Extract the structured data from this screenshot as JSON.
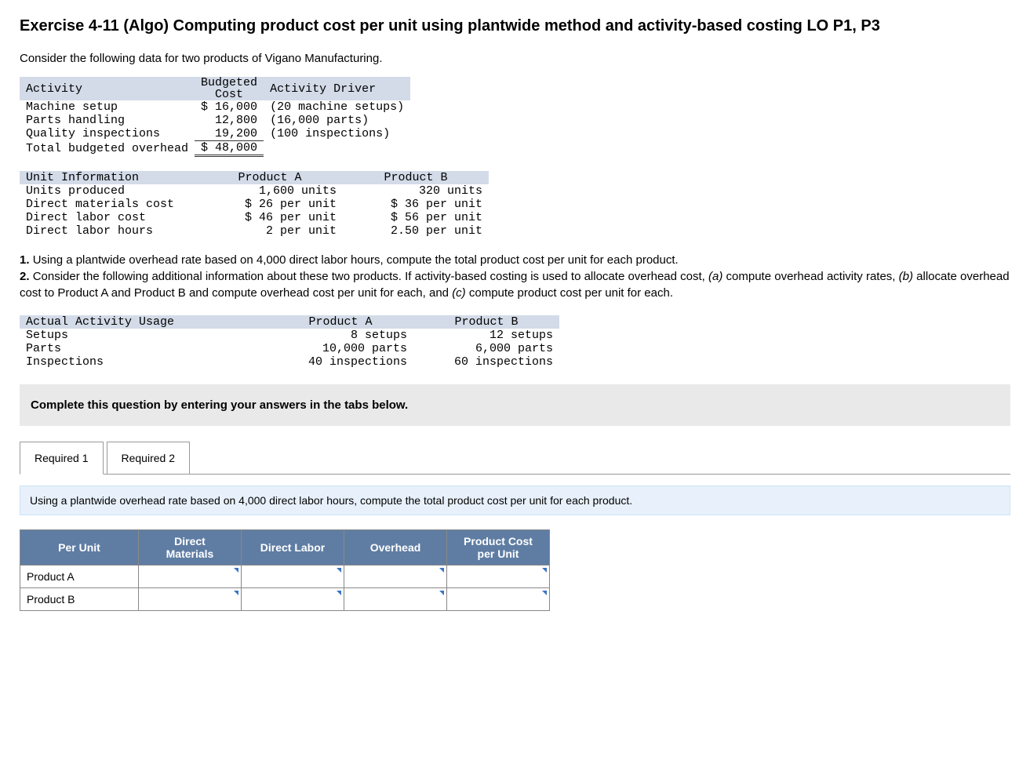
{
  "title": "Exercise 4-11 (Algo) Computing product cost per unit using plantwide method and activity-based costing LO P1, P3",
  "intro": "Consider the following data for two products of Vigano Manufacturing.",
  "table1": {
    "headers": {
      "activity": "Activity",
      "budgeted": "Budgeted\nCost",
      "driver": "Activity Driver"
    },
    "rows": [
      {
        "activity": "Machine setup",
        "cost": "$ 16,000",
        "driver": "(20 machine setups)"
      },
      {
        "activity": "Parts handling",
        "cost": "12,800",
        "driver": "(16,000 parts)"
      },
      {
        "activity": "Quality inspections",
        "cost": "19,200",
        "driver": "(100 inspections)"
      }
    ],
    "total_label": "Total budgeted overhead",
    "total_cost": "$ 48,000"
  },
  "table2": {
    "headers": {
      "info": "Unit Information",
      "a": "Product A",
      "b": "Product B"
    },
    "rows": [
      {
        "label": "Units produced",
        "a": "1,600 units",
        "b": "320 units"
      },
      {
        "label": "Direct materials cost",
        "a": "$ 26 per unit",
        "b": "$ 36 per unit"
      },
      {
        "label": "Direct labor cost",
        "a": "$ 46 per unit",
        "b": "$ 56 per unit"
      },
      {
        "label": "Direct labor hours",
        "a": "2 per unit",
        "b": "2.50 per unit"
      }
    ]
  },
  "questions": {
    "q1_num": "1.",
    "q1": "Using a plantwide overhead rate based on 4,000 direct labor hours, compute the total product cost per unit for each product.",
    "q2_num": "2.",
    "q2_lead": "Consider the following additional information about these two products. If activity-based costing is used to allocate overhead cost, ",
    "q2a_i": "(a)",
    "q2a": " compute overhead activity rates, ",
    "q2b_i": "(b)",
    "q2b": " allocate overhead cost to Product A and Product B and compute overhead cost per unit for each, and ",
    "q2c_i": "(c)",
    "q2c": " compute product cost per unit for each."
  },
  "table3": {
    "headers": {
      "usage": "Actual Activity Usage",
      "a": "Product A",
      "b": "Product B"
    },
    "rows": [
      {
        "label": "Setups",
        "a": "8 setups",
        "b": "12 setups"
      },
      {
        "label": "Parts",
        "a": "10,000 parts",
        "b": "6,000 parts"
      },
      {
        "label": "Inspections",
        "a": "40 inspections",
        "b": "60 inspections"
      }
    ]
  },
  "instruction": "Complete this question by entering your answers in the tabs below.",
  "tabs": {
    "t1": "Required 1",
    "t2": "Required 2"
  },
  "panel": {
    "prompt": "Using a plantwide overhead rate based on 4,000 direct labor hours, compute the total product cost per unit for each product.",
    "headers": {
      "per_unit": "Per Unit",
      "dm": "Direct\nMaterials",
      "dl": "Direct Labor",
      "oh": "Overhead",
      "pc": "Product Cost\nper Unit"
    },
    "row_a": "Product A",
    "row_b": "Product B"
  }
}
